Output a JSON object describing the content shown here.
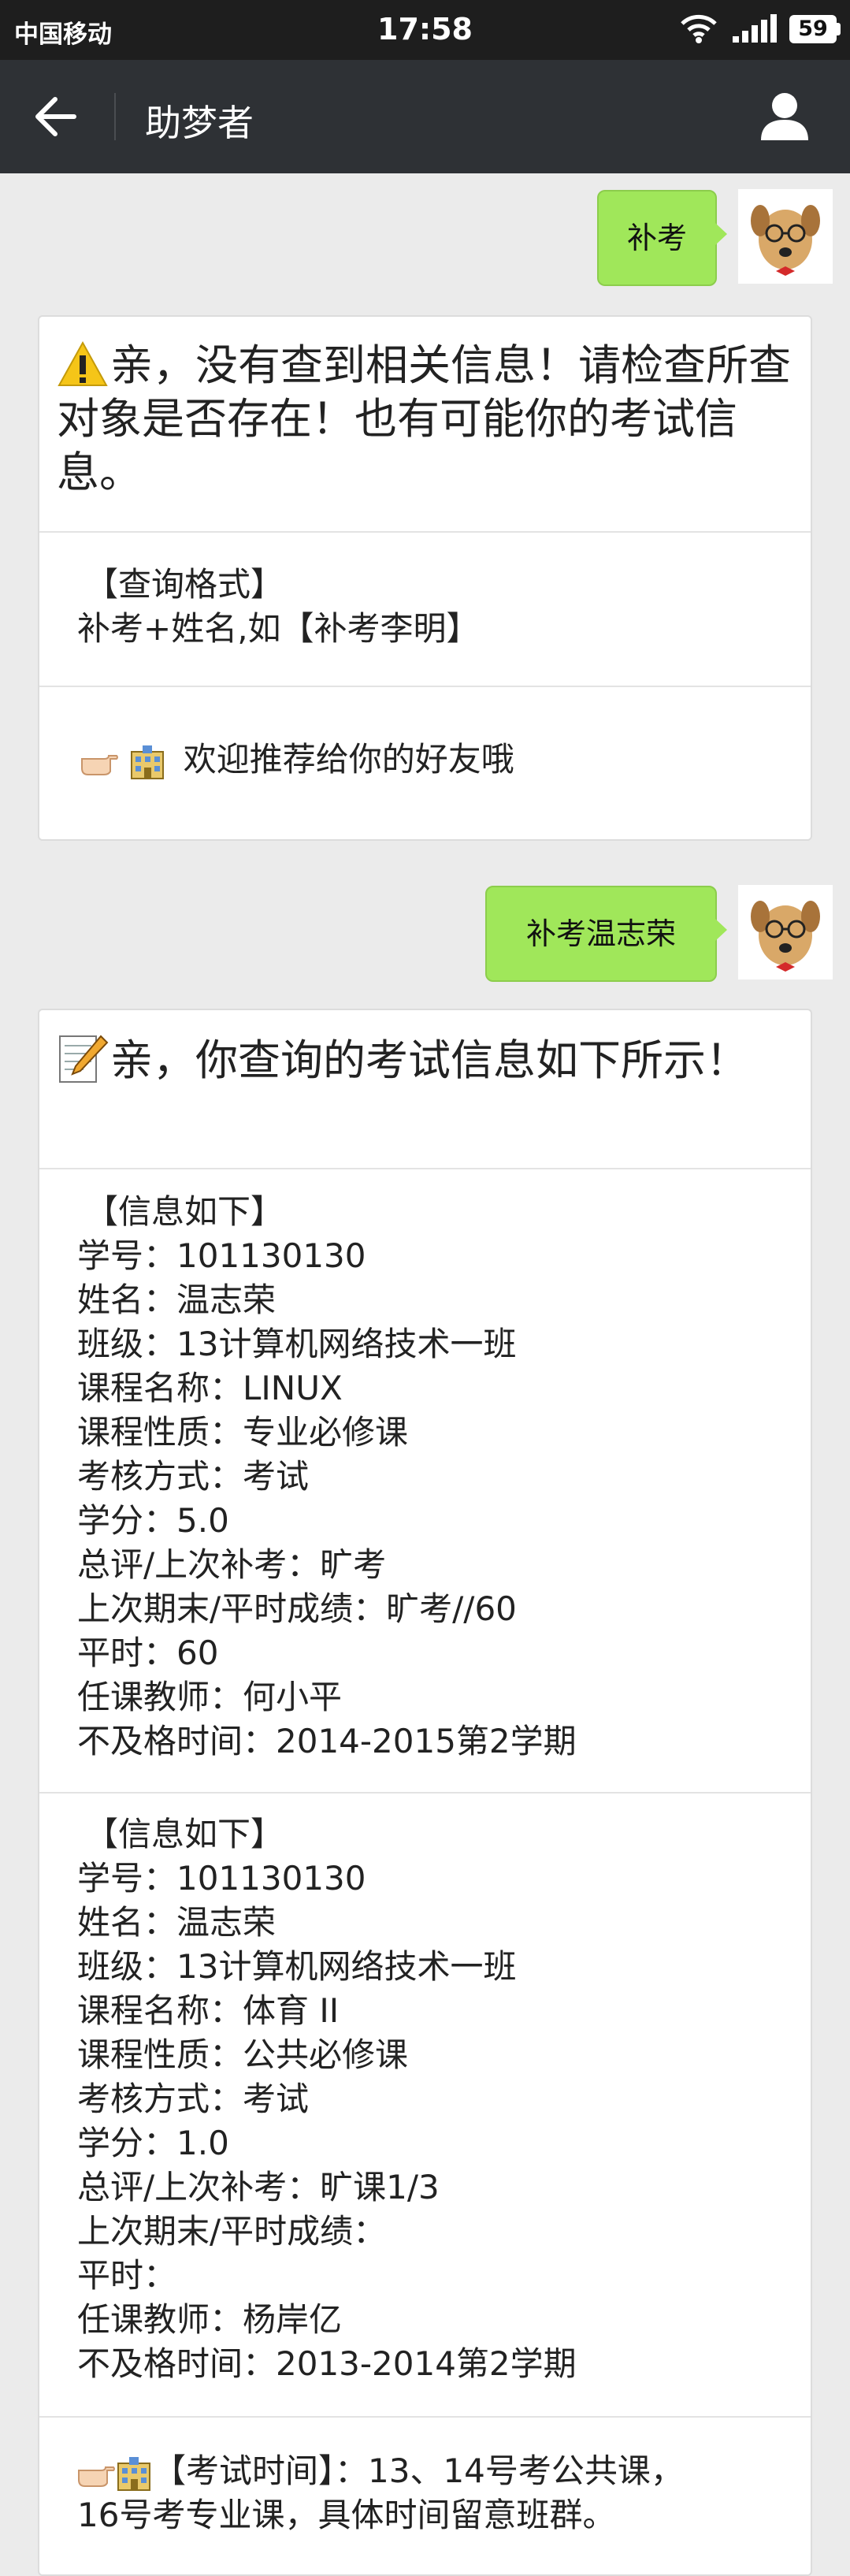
{
  "status_bar": {
    "carrier": "中国移动",
    "time": "17:58",
    "battery": "59"
  },
  "nav": {
    "title": "助梦者"
  },
  "messages": {
    "sent1": "补考",
    "reply1": {
      "headline": "亲，没有查到相关信息！请检查所查对象是否存在！也有可能你的考试信息。",
      "format_title": "【查询格式】",
      "format_body": "补考+姓名,如【补考李明】",
      "share": "欢迎推荐给你的好友哦"
    },
    "sent2": "补考温志荣",
    "reply2": {
      "headline": "亲，你查询的考试信息如下所示！",
      "records": [
        {
          "title": "【信息如下】",
          "student_id": "学号：101130130",
          "name": "姓名：温志荣",
          "class": "班级：13计算机网络技术一班",
          "course": "课程名称：LINUX",
          "nature": "课程性质：专业必修课",
          "assess": "考核方式：考试",
          "credit": "学分：5.0",
          "overall": "总评/上次补考：旷考",
          "last_final": "上次期末/平时成绩：旷考//60",
          "usual": "平时：60",
          "teacher": "任课教师：何小平",
          "fail_term": "不及格时间：2014-2015第2学期"
        },
        {
          "title": "【信息如下】",
          "student_id": "学号：101130130",
          "name": "姓名：温志荣",
          "class": "班级：13计算机网络技术一班",
          "course": "课程名称：体育 II",
          "nature": "课程性质：公共必修课",
          "assess": "考核方式：考试",
          "credit": "学分：1.0",
          "overall": "总评/上次补考：旷课1/3",
          "last_final": "上次期末/平时成绩：",
          "usual": "平时：",
          "teacher": "任课教师：杨岸亿",
          "fail_term": "不及格时间：2013-2014第2学期"
        }
      ],
      "exam_time_line1": "【考试时间】：13、14号考公共课，",
      "exam_time_line2": "16号考专业课，具体时间留意班群。"
    }
  },
  "colors": {
    "status_bar": "#1e1e1e",
    "nav_bar": "#2e3135",
    "background": "#ebebeb",
    "bubble_sent": "#a0e75a"
  },
  "icons": {
    "back": "arrow-left-icon",
    "profile": "person-icon",
    "warning": "warning-icon",
    "memo": "memo-icon",
    "pointing": "hand-pointing-icon",
    "building": "school-building-icon"
  }
}
